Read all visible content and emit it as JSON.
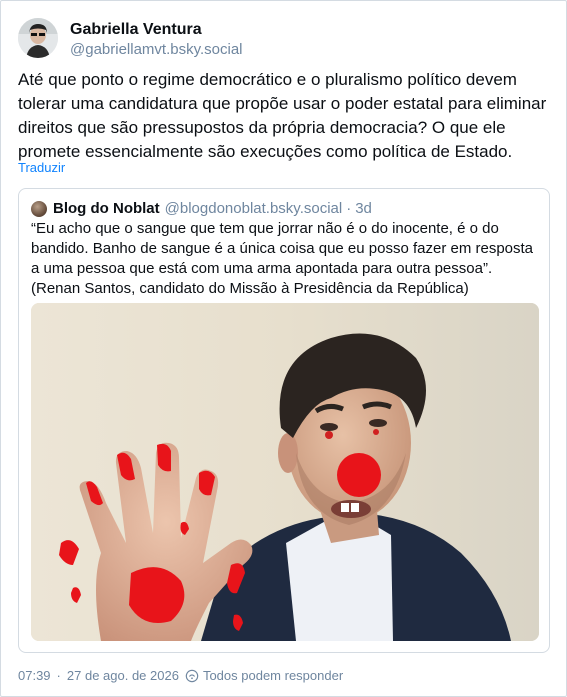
{
  "post": {
    "author_name": "Gabriella Ventura",
    "author_handle": "@gabriellamvt.bsky.social",
    "text": "Até que ponto o regime democrático e o pluralismo político devem tolerar uma candidatura que propõe usar o poder estatal para eliminar direitos que são pressupostos da própria democracia? O que ele promete essencialmente são execuções como política de Estado.",
    "translate_label": "Traduzir"
  },
  "quote": {
    "author_name": "Blog do Noblat",
    "author_handle": "@blogdonoblat.bsky.social",
    "time": "3d",
    "text": "“Eu acho que o sangue que tem que jorrar não é o do inocente, é o do bandido. Banho de sangue é a única coisa que eu posso fazer em resposta a uma pessoa que está com uma arma apontada para outra pessoa”. (Renan Santos, candidato do Missão à Presidência da República)"
  },
  "footer": {
    "time": "07:39",
    "date": "27 de ago. de 2026",
    "reply_setting": "Todos podem responder"
  },
  "icons": {
    "reply_setting": "reply-everyone-icon"
  },
  "colors": {
    "accent_link": "#1083fe",
    "muted_text": "#6f869f",
    "border": "#d4dbe2",
    "clown_red": "#e8141a"
  }
}
